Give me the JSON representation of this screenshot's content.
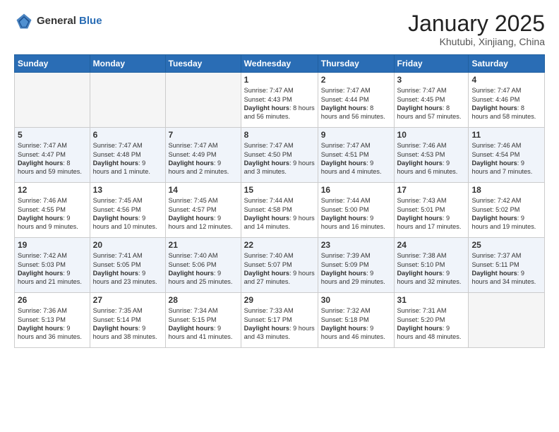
{
  "header": {
    "logo_general": "General",
    "logo_blue": "Blue",
    "month_title": "January 2025",
    "subtitle": "Khutubi, Xinjiang, China"
  },
  "weekdays": [
    "Sunday",
    "Monday",
    "Tuesday",
    "Wednesday",
    "Thursday",
    "Friday",
    "Saturday"
  ],
  "weeks": [
    [
      {
        "day": "",
        "info": ""
      },
      {
        "day": "",
        "info": ""
      },
      {
        "day": "",
        "info": ""
      },
      {
        "day": "1",
        "info": "Sunrise: 7:47 AM\nSunset: 4:43 PM\nDaylight: 8 hours and 56 minutes."
      },
      {
        "day": "2",
        "info": "Sunrise: 7:47 AM\nSunset: 4:44 PM\nDaylight: 8 hours and 56 minutes."
      },
      {
        "day": "3",
        "info": "Sunrise: 7:47 AM\nSunset: 4:45 PM\nDaylight: 8 hours and 57 minutes."
      },
      {
        "day": "4",
        "info": "Sunrise: 7:47 AM\nSunset: 4:46 PM\nDaylight: 8 hours and 58 minutes."
      }
    ],
    [
      {
        "day": "5",
        "info": "Sunrise: 7:47 AM\nSunset: 4:47 PM\nDaylight: 8 hours and 59 minutes."
      },
      {
        "day": "6",
        "info": "Sunrise: 7:47 AM\nSunset: 4:48 PM\nDaylight: 9 hours and 1 minute."
      },
      {
        "day": "7",
        "info": "Sunrise: 7:47 AM\nSunset: 4:49 PM\nDaylight: 9 hours and 2 minutes."
      },
      {
        "day": "8",
        "info": "Sunrise: 7:47 AM\nSunset: 4:50 PM\nDaylight: 9 hours and 3 minutes."
      },
      {
        "day": "9",
        "info": "Sunrise: 7:47 AM\nSunset: 4:51 PM\nDaylight: 9 hours and 4 minutes."
      },
      {
        "day": "10",
        "info": "Sunrise: 7:46 AM\nSunset: 4:53 PM\nDaylight: 9 hours and 6 minutes."
      },
      {
        "day": "11",
        "info": "Sunrise: 7:46 AM\nSunset: 4:54 PM\nDaylight: 9 hours and 7 minutes."
      }
    ],
    [
      {
        "day": "12",
        "info": "Sunrise: 7:46 AM\nSunset: 4:55 PM\nDaylight: 9 hours and 9 minutes."
      },
      {
        "day": "13",
        "info": "Sunrise: 7:45 AM\nSunset: 4:56 PM\nDaylight: 9 hours and 10 minutes."
      },
      {
        "day": "14",
        "info": "Sunrise: 7:45 AM\nSunset: 4:57 PM\nDaylight: 9 hours and 12 minutes."
      },
      {
        "day": "15",
        "info": "Sunrise: 7:44 AM\nSunset: 4:58 PM\nDaylight: 9 hours and 14 minutes."
      },
      {
        "day": "16",
        "info": "Sunrise: 7:44 AM\nSunset: 5:00 PM\nDaylight: 9 hours and 16 minutes."
      },
      {
        "day": "17",
        "info": "Sunrise: 7:43 AM\nSunset: 5:01 PM\nDaylight: 9 hours and 17 minutes."
      },
      {
        "day": "18",
        "info": "Sunrise: 7:42 AM\nSunset: 5:02 PM\nDaylight: 9 hours and 19 minutes."
      }
    ],
    [
      {
        "day": "19",
        "info": "Sunrise: 7:42 AM\nSunset: 5:03 PM\nDaylight: 9 hours and 21 minutes."
      },
      {
        "day": "20",
        "info": "Sunrise: 7:41 AM\nSunset: 5:05 PM\nDaylight: 9 hours and 23 minutes."
      },
      {
        "day": "21",
        "info": "Sunrise: 7:40 AM\nSunset: 5:06 PM\nDaylight: 9 hours and 25 minutes."
      },
      {
        "day": "22",
        "info": "Sunrise: 7:40 AM\nSunset: 5:07 PM\nDaylight: 9 hours and 27 minutes."
      },
      {
        "day": "23",
        "info": "Sunrise: 7:39 AM\nSunset: 5:09 PM\nDaylight: 9 hours and 29 minutes."
      },
      {
        "day": "24",
        "info": "Sunrise: 7:38 AM\nSunset: 5:10 PM\nDaylight: 9 hours and 32 minutes."
      },
      {
        "day": "25",
        "info": "Sunrise: 7:37 AM\nSunset: 5:11 PM\nDaylight: 9 hours and 34 minutes."
      }
    ],
    [
      {
        "day": "26",
        "info": "Sunrise: 7:36 AM\nSunset: 5:13 PM\nDaylight: 9 hours and 36 minutes."
      },
      {
        "day": "27",
        "info": "Sunrise: 7:35 AM\nSunset: 5:14 PM\nDaylight: 9 hours and 38 minutes."
      },
      {
        "day": "28",
        "info": "Sunrise: 7:34 AM\nSunset: 5:15 PM\nDaylight: 9 hours and 41 minutes."
      },
      {
        "day": "29",
        "info": "Sunrise: 7:33 AM\nSunset: 5:17 PM\nDaylight: 9 hours and 43 minutes."
      },
      {
        "day": "30",
        "info": "Sunrise: 7:32 AM\nSunset: 5:18 PM\nDaylight: 9 hours and 46 minutes."
      },
      {
        "day": "31",
        "info": "Sunrise: 7:31 AM\nSunset: 5:20 PM\nDaylight: 9 hours and 48 minutes."
      },
      {
        "day": "",
        "info": ""
      }
    ]
  ],
  "colors": {
    "header_bg": "#2a6db5",
    "row_alt": "#e8eef7"
  }
}
